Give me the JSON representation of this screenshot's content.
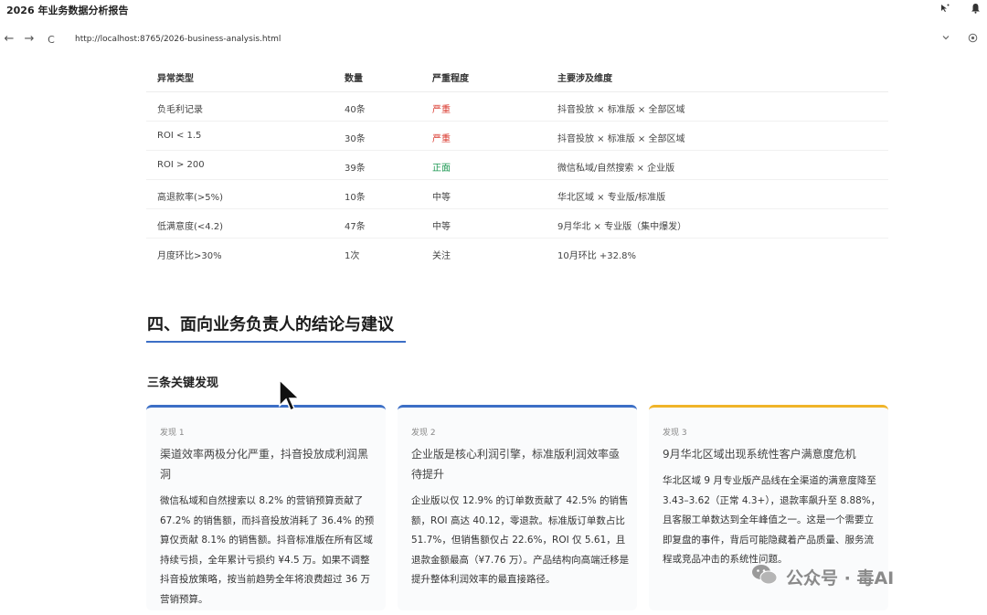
{
  "window": {
    "title": "2026 年业务数据分析报告"
  },
  "browser": {
    "url": "http://localhost:8765/2026-business-analysis.html",
    "back_glyph": "←",
    "forward_glyph": "→",
    "reload_glyph": "C"
  },
  "anomaly_table": {
    "headers": [
      "异常类型",
      "数量",
      "严重程度",
      "主要涉及维度"
    ],
    "rows": [
      {
        "type": "负毛利记录",
        "count": "40条",
        "severity": "严重",
        "severity_level": "red",
        "dimension": "抖音投放 × 标准版 × 全部区域"
      },
      {
        "type": "ROI < 1.5",
        "count": "30条",
        "severity": "严重",
        "severity_level": "red",
        "dimension": "抖音投放 × 标准版 × 全部区域"
      },
      {
        "type": "ROI > 200",
        "count": "39条",
        "severity": "正面",
        "severity_level": "green",
        "dimension": "微信私域/自然搜索 × 企业版"
      },
      {
        "type": "高退款率(>5%)",
        "count": "10条",
        "severity": "中等",
        "severity_level": "gray",
        "dimension": "华北区域 × 专业版/标准版"
      },
      {
        "type": "低满意度(<4.2)",
        "count": "47条",
        "severity": "中等",
        "severity_level": "gray",
        "dimension": "9月华北 × 专业版（集中爆发）"
      },
      {
        "type": "月度环比>30%",
        "count": "1次",
        "severity": "关注",
        "severity_level": "gray",
        "dimension": "10月环比 +32.8%"
      }
    ]
  },
  "section": {
    "title": "四、面向业务负责人的结论与建议",
    "subtitle": "三条关键发现"
  },
  "findings": [
    {
      "tag": "发现 1",
      "title": "渠道效率两极分化严重，抖音投放成利润黑洞",
      "body": "微信私域和自然搜索以 8.2% 的营销预算贡献了 67.2% 的销售额，而抖音投放消耗了 36.4% 的预算仅贡献 8.1% 的销售额。抖音标准版在所有区域持续亏损，全年累计亏损约 ¥4.5 万。如果不调整抖音投放策略，按当前趋势全年将浪费超过 36 万营销预算。",
      "accent": "#3c6fc6"
    },
    {
      "tag": "发现 2",
      "title": "企业版是核心利润引擎，标准版利润效率亟待提升",
      "body": "企业版以仅 12.9% 的订单数贡献了 42.5% 的销售额，ROI 高达 40.12，零退款。标准版订单数占比 51.7%，但销售额仅占 22.6%，ROI 仅 5.61，且退款金额最高（¥7.76 万）。产品结构向高端迁移是提升整体利润效率的最直接路径。",
      "accent": "#3c6fc6"
    },
    {
      "tag": "发现 3",
      "title": "9月华北区域出现系统性客户满意度危机",
      "body": "华北区域 9 月专业版产品线在全渠道的满意度降至 3.43–3.62（正常 4.3+），退款率飙升至 8.88%，且客服工单数达到全年峰值之一。这是一个需要立即复盘的事件，背后可能隐藏着产品质量、服务流程或竞品冲击的系统性问题。",
      "accent": "#f0b429"
    }
  ],
  "watermark": {
    "text": "公众号 · 毒AI"
  },
  "colors": {
    "accent_blue": "#3c6fc6",
    "accent_yellow": "#f0b429",
    "severe_red": "#d9362b",
    "positive_green": "#1f9a55"
  }
}
